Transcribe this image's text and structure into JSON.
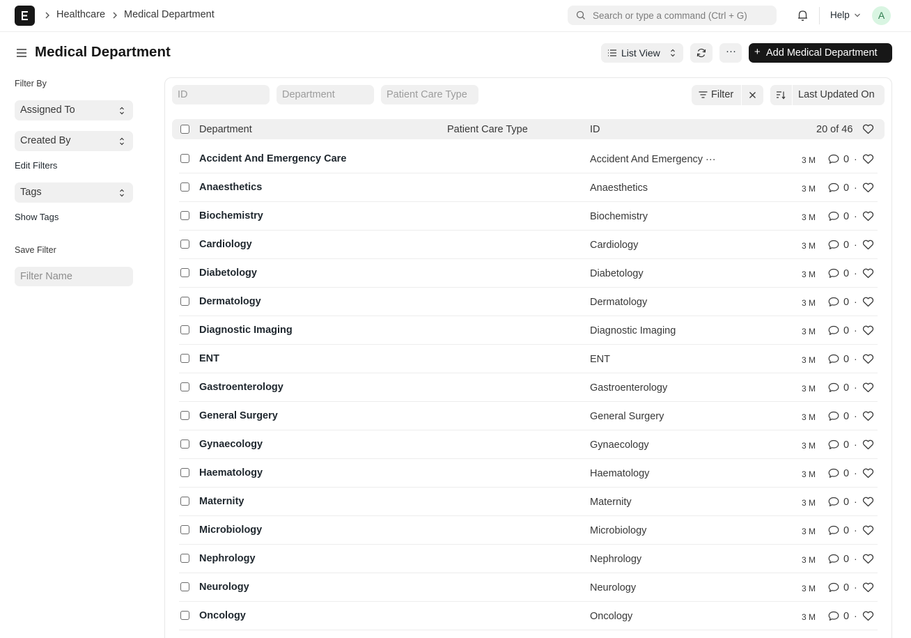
{
  "navbar": {
    "breadcrumbs": [
      "Healthcare",
      "Medical Department"
    ],
    "search_placeholder": "Search or type a command (Ctrl + G)",
    "help_label": "Help",
    "avatar_initial": "A"
  },
  "page": {
    "title": "Medical Department",
    "view_label": "List View",
    "more_label": "···",
    "add_button_label": "Add Medical Department"
  },
  "sidebar": {
    "filter_by_label": "Filter By",
    "assigned_to": "Assigned To",
    "created_by": "Created By",
    "edit_filters": "Edit Filters",
    "tags": "Tags",
    "show_tags": "Show Tags",
    "save_filter_label": "Save Filter",
    "filter_name_placeholder": "Filter Name"
  },
  "filters": {
    "id_placeholder": "ID",
    "department_placeholder": "Department",
    "patient_care_type_placeholder": "Patient Care Type",
    "filter_label": "Filter",
    "sort_label": "Last Updated On"
  },
  "table": {
    "columns": [
      "Department",
      "Patient Care Type",
      "ID"
    ],
    "count": "20 of 46",
    "rows": [
      {
        "department": "Accident And Emergency Care",
        "id": "Accident And Emergency ···",
        "age": "3 M",
        "comments": "0"
      },
      {
        "department": "Anaesthetics",
        "id": "Anaesthetics",
        "age": "3 M",
        "comments": "0"
      },
      {
        "department": "Biochemistry",
        "id": "Biochemistry",
        "age": "3 M",
        "comments": "0"
      },
      {
        "department": "Cardiology",
        "id": "Cardiology",
        "age": "3 M",
        "comments": "0"
      },
      {
        "department": "Diabetology",
        "id": "Diabetology",
        "age": "3 M",
        "comments": "0"
      },
      {
        "department": "Dermatology",
        "id": "Dermatology",
        "age": "3 M",
        "comments": "0"
      },
      {
        "department": "Diagnostic Imaging",
        "id": "Diagnostic Imaging",
        "age": "3 M",
        "comments": "0"
      },
      {
        "department": "ENT",
        "id": "ENT",
        "age": "3 M",
        "comments": "0"
      },
      {
        "department": "Gastroenterology",
        "id": "Gastroenterology",
        "age": "3 M",
        "comments": "0"
      },
      {
        "department": "General Surgery",
        "id": "General Surgery",
        "age": "3 M",
        "comments": "0"
      },
      {
        "department": "Gynaecology",
        "id": "Gynaecology",
        "age": "3 M",
        "comments": "0"
      },
      {
        "department": "Haematology",
        "id": "Haematology",
        "age": "3 M",
        "comments": "0"
      },
      {
        "department": "Maternity",
        "id": "Maternity",
        "age": "3 M",
        "comments": "0"
      },
      {
        "department": "Microbiology",
        "id": "Microbiology",
        "age": "3 M",
        "comments": "0"
      },
      {
        "department": "Nephrology",
        "id": "Nephrology",
        "age": "3 M",
        "comments": "0"
      },
      {
        "department": "Neurology",
        "id": "Neurology",
        "age": "3 M",
        "comments": "0"
      },
      {
        "department": "Oncology",
        "id": "Oncology",
        "age": "3 M",
        "comments": "0"
      }
    ]
  }
}
